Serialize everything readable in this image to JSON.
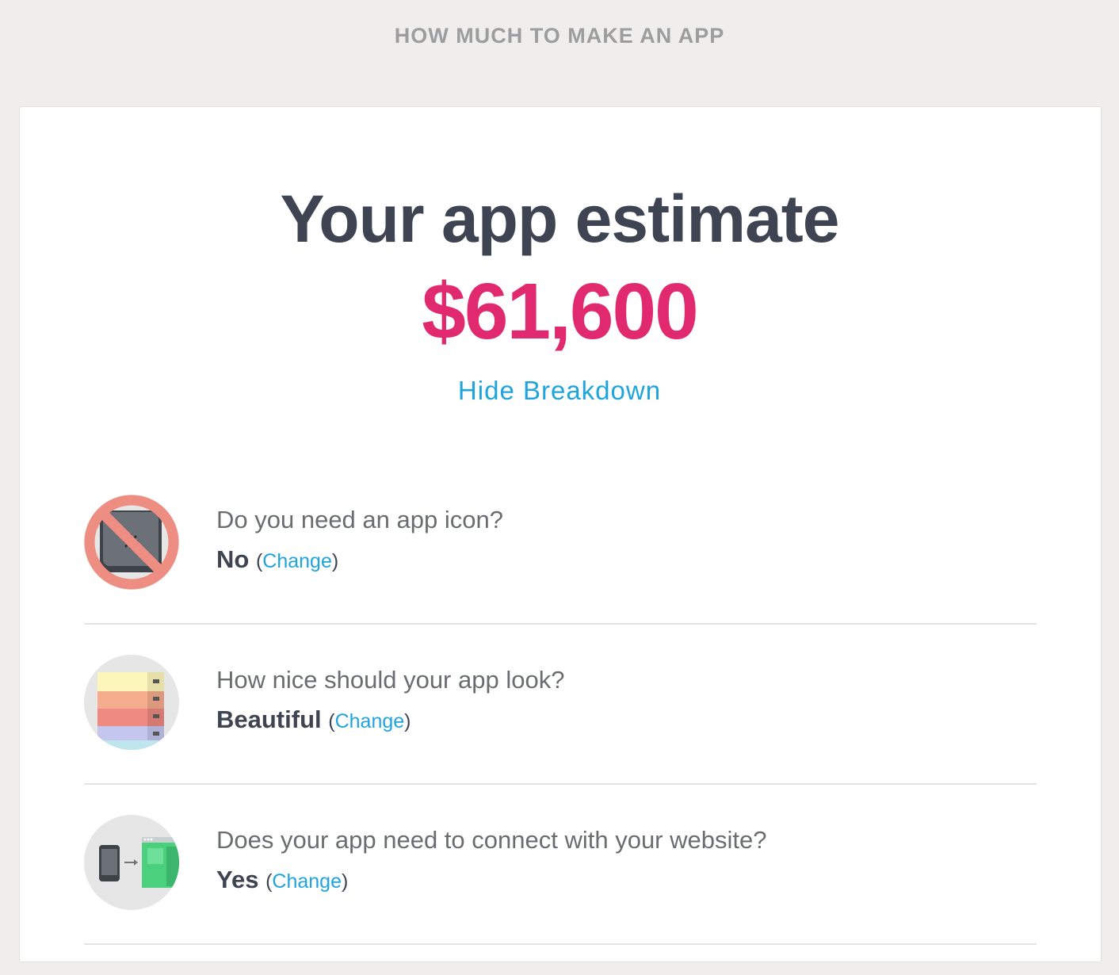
{
  "header": {
    "title": "HOW MUCH TO MAKE AN APP"
  },
  "estimate": {
    "title": "Your app estimate",
    "price": "$61,600",
    "toggle_label": "Hide Breakdown"
  },
  "breakdown": [
    {
      "question": "Do you need an app icon?",
      "answer": "No",
      "open_paren": "(",
      "change_label": "Change",
      "close_paren": ")",
      "icon": "no-app-icon-icon"
    },
    {
      "question": "How nice should your app look?",
      "answer": "Beautiful",
      "open_paren": "(",
      "change_label": "Change",
      "close_paren": ")",
      "icon": "design-swatches-icon"
    },
    {
      "question": "Does your app need to connect with your website?",
      "answer": "Yes",
      "open_paren": "(",
      "change_label": "Change",
      "close_paren": ")",
      "icon": "phone-to-website-icon"
    }
  ],
  "colors": {
    "accent_price": "#e0296f",
    "link": "#1fa4dd",
    "heading": "#3e4451",
    "background": "#efeeec"
  }
}
